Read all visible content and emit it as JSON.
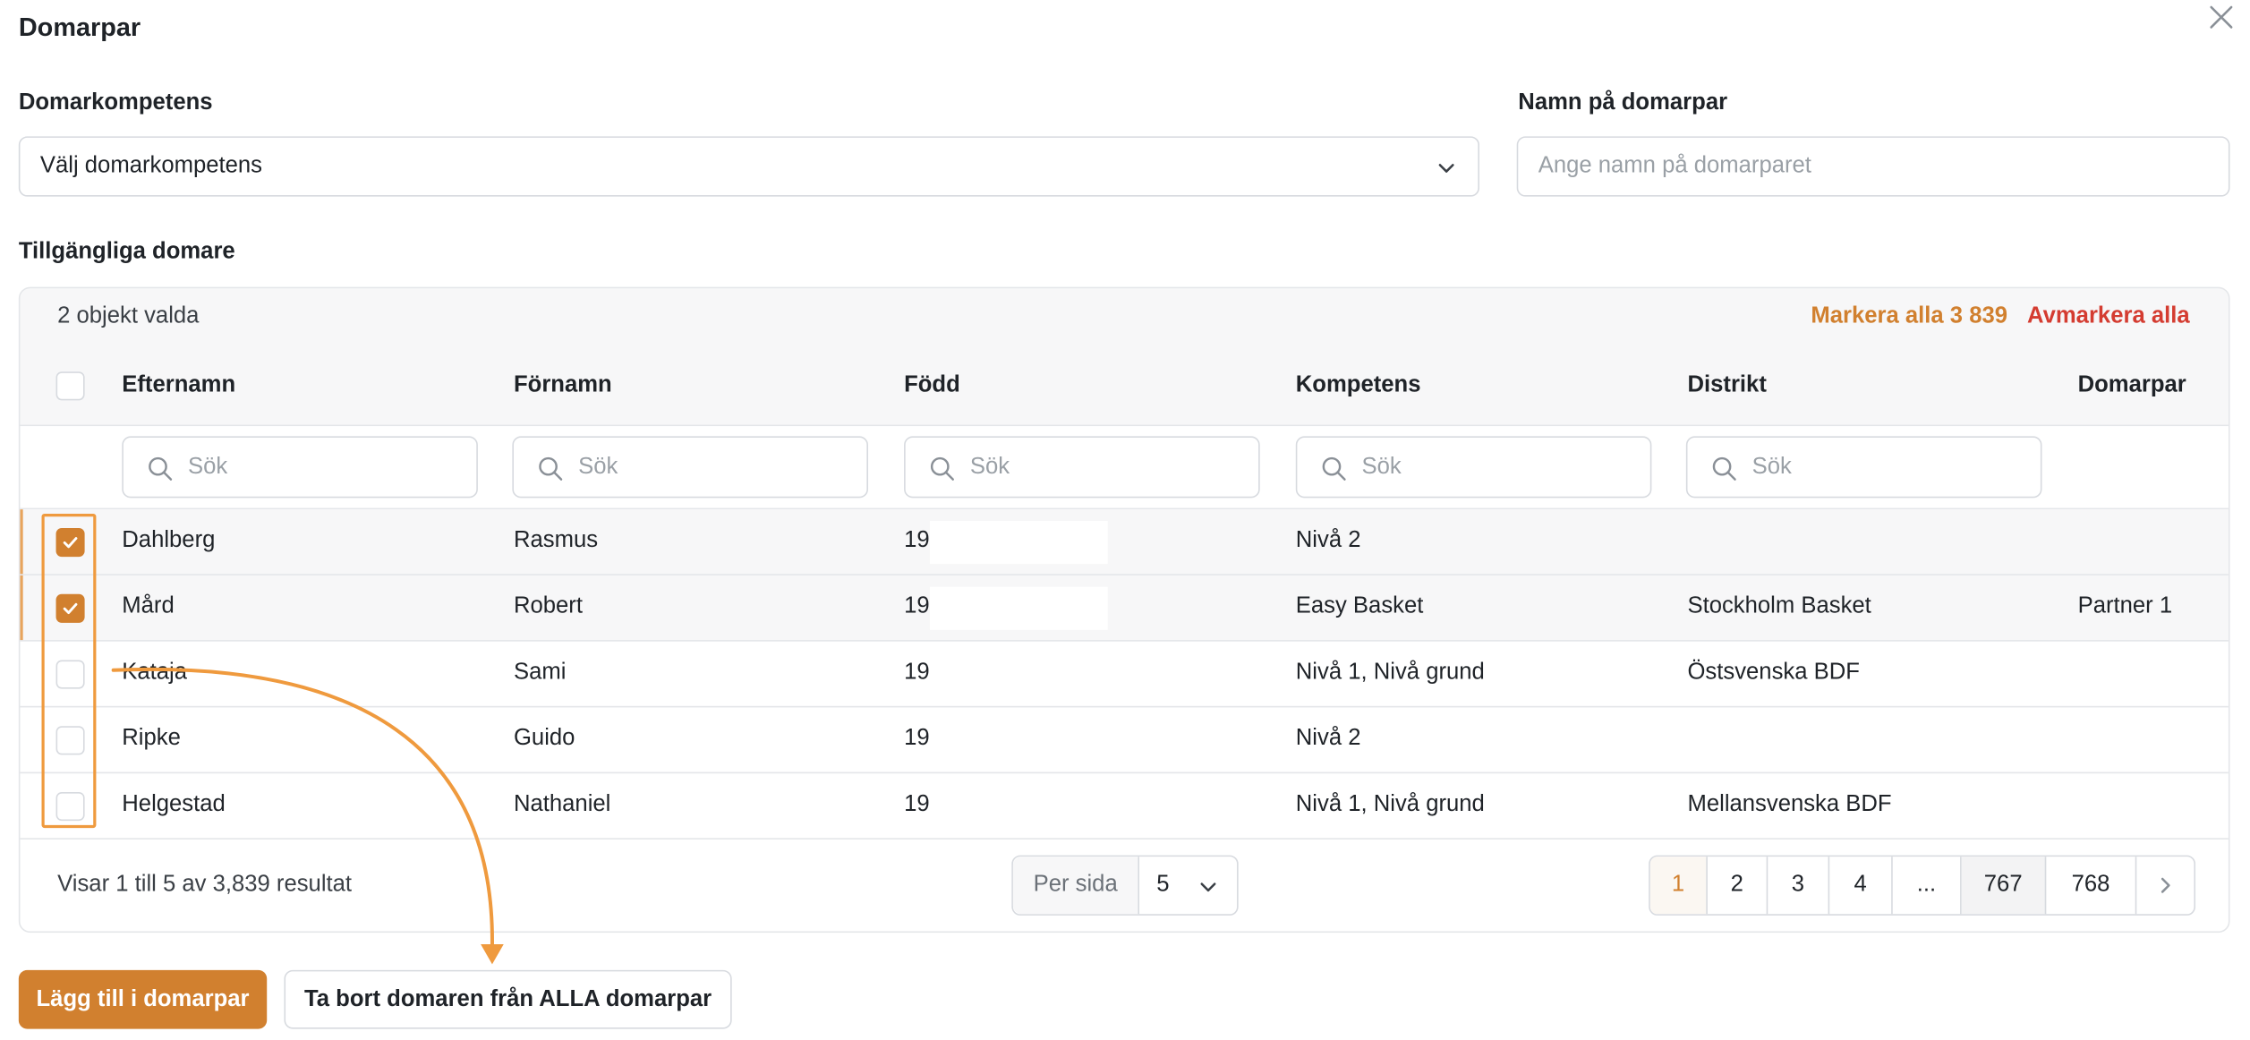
{
  "modal": {
    "title": "Domarpar",
    "close_icon": "close-icon"
  },
  "competence": {
    "label": "Domarkompetens",
    "selected": "Välj domarkompetens"
  },
  "pair_name": {
    "label": "Namn på domarpar",
    "placeholder": "Ange namn på domarparet",
    "value": ""
  },
  "available": {
    "label": "Tillgängliga domare",
    "selected_count_text": "2 objekt valda",
    "select_all_label": "Markera alla 3 839",
    "deselect_all_label": "Avmarkera alla"
  },
  "columns": [
    "Efternamn",
    "Förnamn",
    "Född",
    "Kompetens",
    "Distrikt",
    "Domarpar"
  ],
  "search_placeholder": "Sök",
  "rows": [
    {
      "checked": true,
      "lastname": "Dahlberg",
      "firstname": "Rasmus",
      "born": "19",
      "competence": "Nivå 2",
      "district": "",
      "pair": ""
    },
    {
      "checked": true,
      "lastname": "Mård",
      "firstname": "Robert",
      "born": "19",
      "competence": "Easy Basket",
      "district": "Stockholm Basket",
      "pair": "Partner 1"
    },
    {
      "checked": false,
      "lastname": "Kataja",
      "firstname": "Sami",
      "born": "19",
      "competence": "Nivå 1, Nivå grund",
      "district": "Östsvenska BDF",
      "pair": ""
    },
    {
      "checked": false,
      "lastname": "Ripke",
      "firstname": "Guido",
      "born": "19",
      "competence": "Nivå 2",
      "district": "",
      "pair": ""
    },
    {
      "checked": false,
      "lastname": "Helgestad",
      "firstname": "Nathaniel",
      "born": "19",
      "competence": "Nivå 1, Nivå grund",
      "district": "Mellansvenska BDF",
      "pair": ""
    }
  ],
  "footer": {
    "results_text": "Visar 1 till 5 av 3,839 resultat",
    "per_page_label": "Per sida",
    "per_page_value": "5",
    "pages": [
      "1",
      "2",
      "3",
      "4",
      "...",
      "767",
      "768"
    ],
    "current_page": "1"
  },
  "actions": {
    "add_label": "Lägg till i domarpar",
    "remove_label": "Ta bort domaren från ALLA domarpar"
  },
  "colors": {
    "accent": "#d1802f",
    "danger": "#d43c31",
    "annotation": "#ef9a3e"
  }
}
